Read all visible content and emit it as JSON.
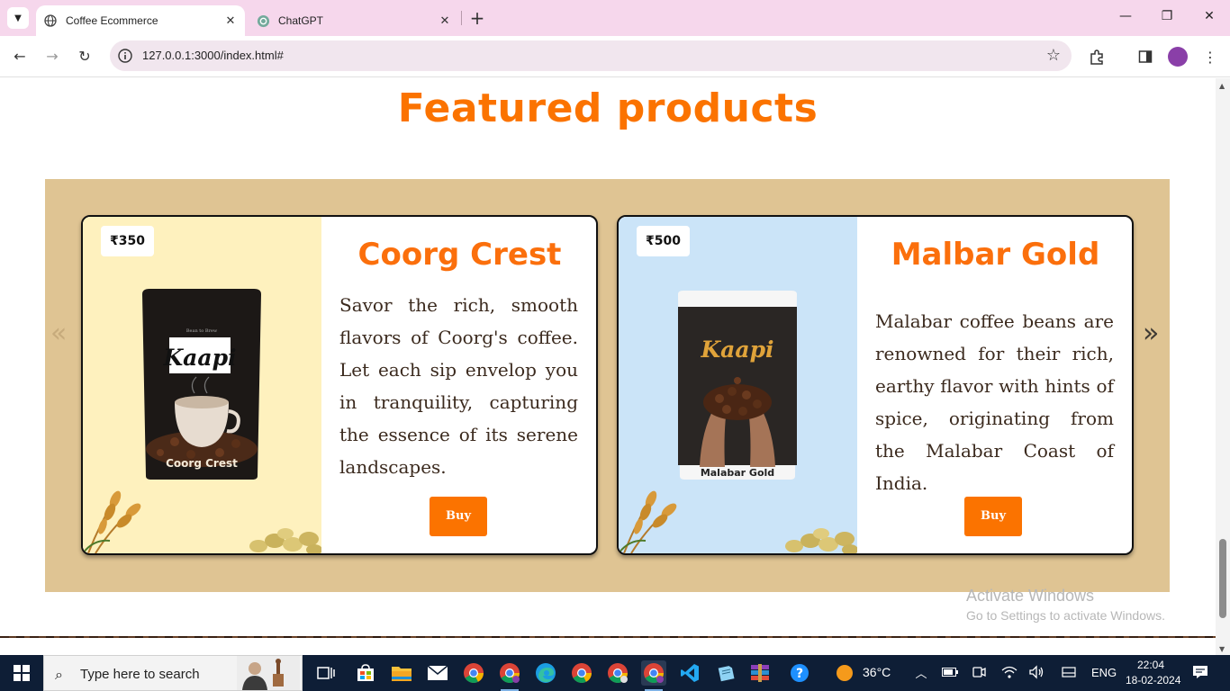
{
  "browser": {
    "tabs": [
      {
        "title": "Coffee Ecommerce",
        "active": true
      },
      {
        "title": "ChatGPT",
        "active": false
      }
    ],
    "url": "127.0.0.1:3000/index.html#"
  },
  "page": {
    "section_title": "Featured products",
    "products": [
      {
        "price": "₹350",
        "name": "Coorg Crest",
        "description": "Savor the rich, smooth flavors of Coorg's coffee. Let each sip envelop you in tranquility, capturing the essence of its serene landscapes.",
        "buy_label": "Buy",
        "bag_brand": "Kaapi",
        "bag_label": "Coorg Crest",
        "bag_tagline": "Bean to Brew"
      },
      {
        "price": "₹500",
        "name": "Malbar Gold",
        "description": "Malabar coffee beans are renowned for their rich, earthy flavor with hints of spice, originating from the Malabar Coast of India.",
        "buy_label": "Buy",
        "bag_brand": "Kaapi",
        "bag_label": "Malabar Gold"
      }
    ],
    "prev_arrow": "«",
    "next_arrow": "»"
  },
  "watermark": {
    "line1": "Activate Windows",
    "line2": "Go to Settings to activate Windows."
  },
  "taskbar": {
    "search_placeholder": "Type here to search",
    "weather": "36°C",
    "language": "ENG",
    "time": "22:04",
    "date": "18-02-2024"
  },
  "colors": {
    "accent": "#fb7300",
    "carousel_bg": "#dfc493",
    "card1_panel": "#fef1be",
    "card2_panel": "#cbe4f8"
  }
}
